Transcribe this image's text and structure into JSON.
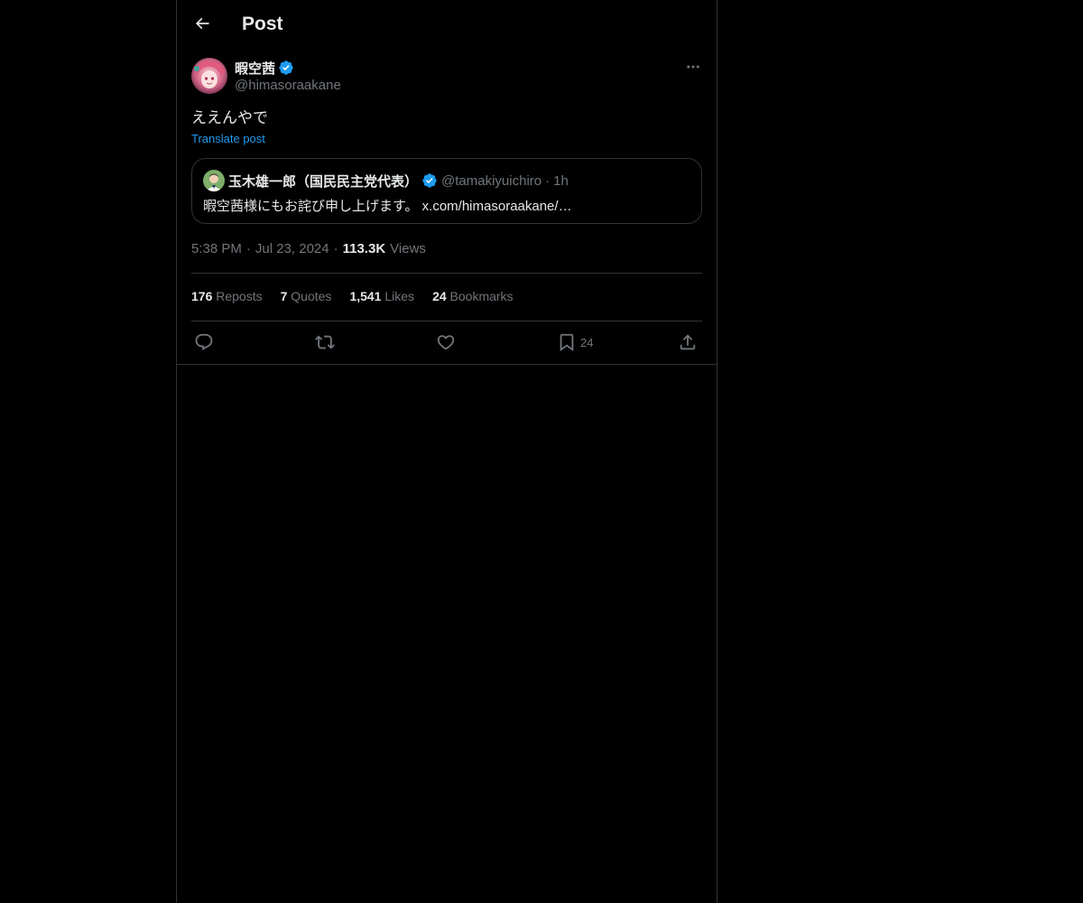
{
  "header": {
    "title": "Post"
  },
  "post": {
    "author_name": "暇空茜",
    "author_handle": "@himasoraakane",
    "text": "ええんやで",
    "translate_label": "Translate post",
    "quote": {
      "author_name": "玉木雄一郎（国民民主党代表）",
      "author_handle": "@tamakiyuichiro",
      "dot": "·",
      "time": "1h",
      "text": "暇空茜様にもお詫び申し上げます。 x.com/himasoraakane/…"
    },
    "meta": {
      "time": "5:38 PM",
      "sep1": "·",
      "date": "Jul 23, 2024",
      "sep2": "·",
      "views_count": "113.3K",
      "views_label": "Views"
    },
    "stats": {
      "reposts_count": "176",
      "reposts_label": "Reposts",
      "quotes_count": "7",
      "quotes_label": "Quotes",
      "likes_count": "1,541",
      "likes_label": "Likes",
      "bookmarks_count": "24",
      "bookmarks_label": "Bookmarks"
    },
    "actions": {
      "bookmark_count": "24"
    }
  },
  "icons": {
    "back": "arrow-left-icon",
    "more": "more-horizontal-icon",
    "verified": "verified-badge-icon",
    "reply": "reply-icon",
    "repost": "repost-icon",
    "like": "heart-icon",
    "bookmark": "bookmark-icon",
    "share": "share-icon"
  },
  "colors": {
    "background": "#000000",
    "text": "#e7e9ea",
    "secondary": "#71767b",
    "accent": "#1d9bf0",
    "border": "#2f3336"
  }
}
